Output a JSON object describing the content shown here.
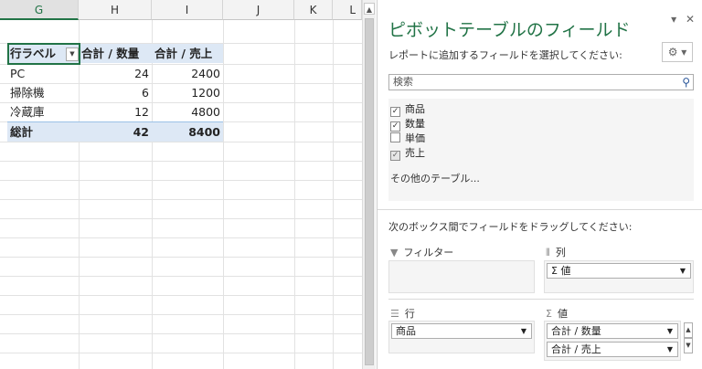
{
  "sheet": {
    "columns": [
      "G",
      "H",
      "I",
      "J",
      "K",
      "L"
    ],
    "selected_column": "G",
    "pivot": {
      "headers": [
        "行ラベル",
        "合計 / 数量",
        "合計 / 売上"
      ],
      "rows": [
        {
          "label": "PC",
          "qty": "24",
          "sales": "2400"
        },
        {
          "label": "掃除機",
          "qty": "6",
          "sales": "1200"
        },
        {
          "label": "冷蔵庫",
          "qty": "12",
          "sales": "4800"
        }
      ],
      "total": {
        "label": "総計",
        "qty": "42",
        "sales": "8400"
      }
    }
  },
  "pane": {
    "title": "ピボットテーブルのフィールド",
    "hint": "レポートに追加するフィールドを選択してください:",
    "search_placeholder": "検索",
    "fields": [
      {
        "label": "商品",
        "checked": true
      },
      {
        "label": "数量",
        "checked": true
      },
      {
        "label": "単価",
        "checked": false
      },
      {
        "label": "売上",
        "checked": true
      }
    ],
    "other_tables": "その他のテーブル...",
    "drag_hint": "次のボックス間でフィールドをドラッグしてください:",
    "zones": {
      "filter_label": "フィルター",
      "columns_label": "列",
      "rows_label": "行",
      "values_label": "値",
      "columns_chip": "Σ 値",
      "rows_chip": "商品",
      "values_chips": [
        "合計 / 数量",
        "合計 / 売上"
      ]
    }
  },
  "colors": {
    "accent": "#217346",
    "pivot_header_bg": "#dde8f5"
  }
}
